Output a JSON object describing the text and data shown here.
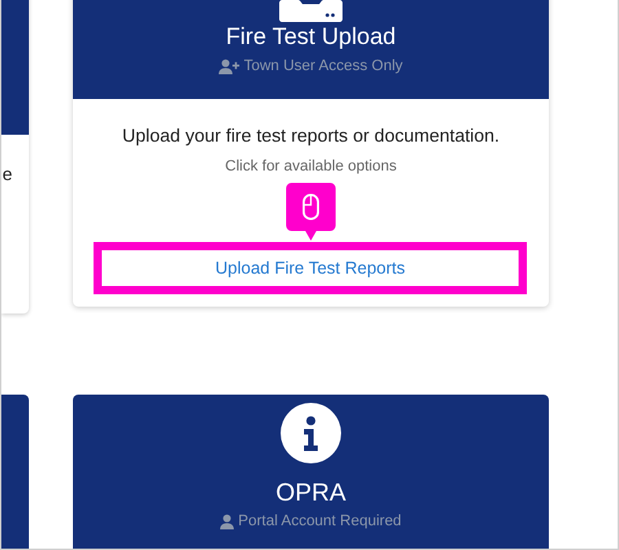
{
  "side_card": {
    "text": "e"
  },
  "cards": [
    {
      "title": "Fire Test Upload",
      "access": "Town User Access Only",
      "description": "Upload your fire test reports or documentation.",
      "hint": "Click for available options",
      "button": "Upload Fire Test Reports",
      "highlighted": true
    },
    {
      "title": "OPRA",
      "access": "Portal Account Required"
    }
  ]
}
